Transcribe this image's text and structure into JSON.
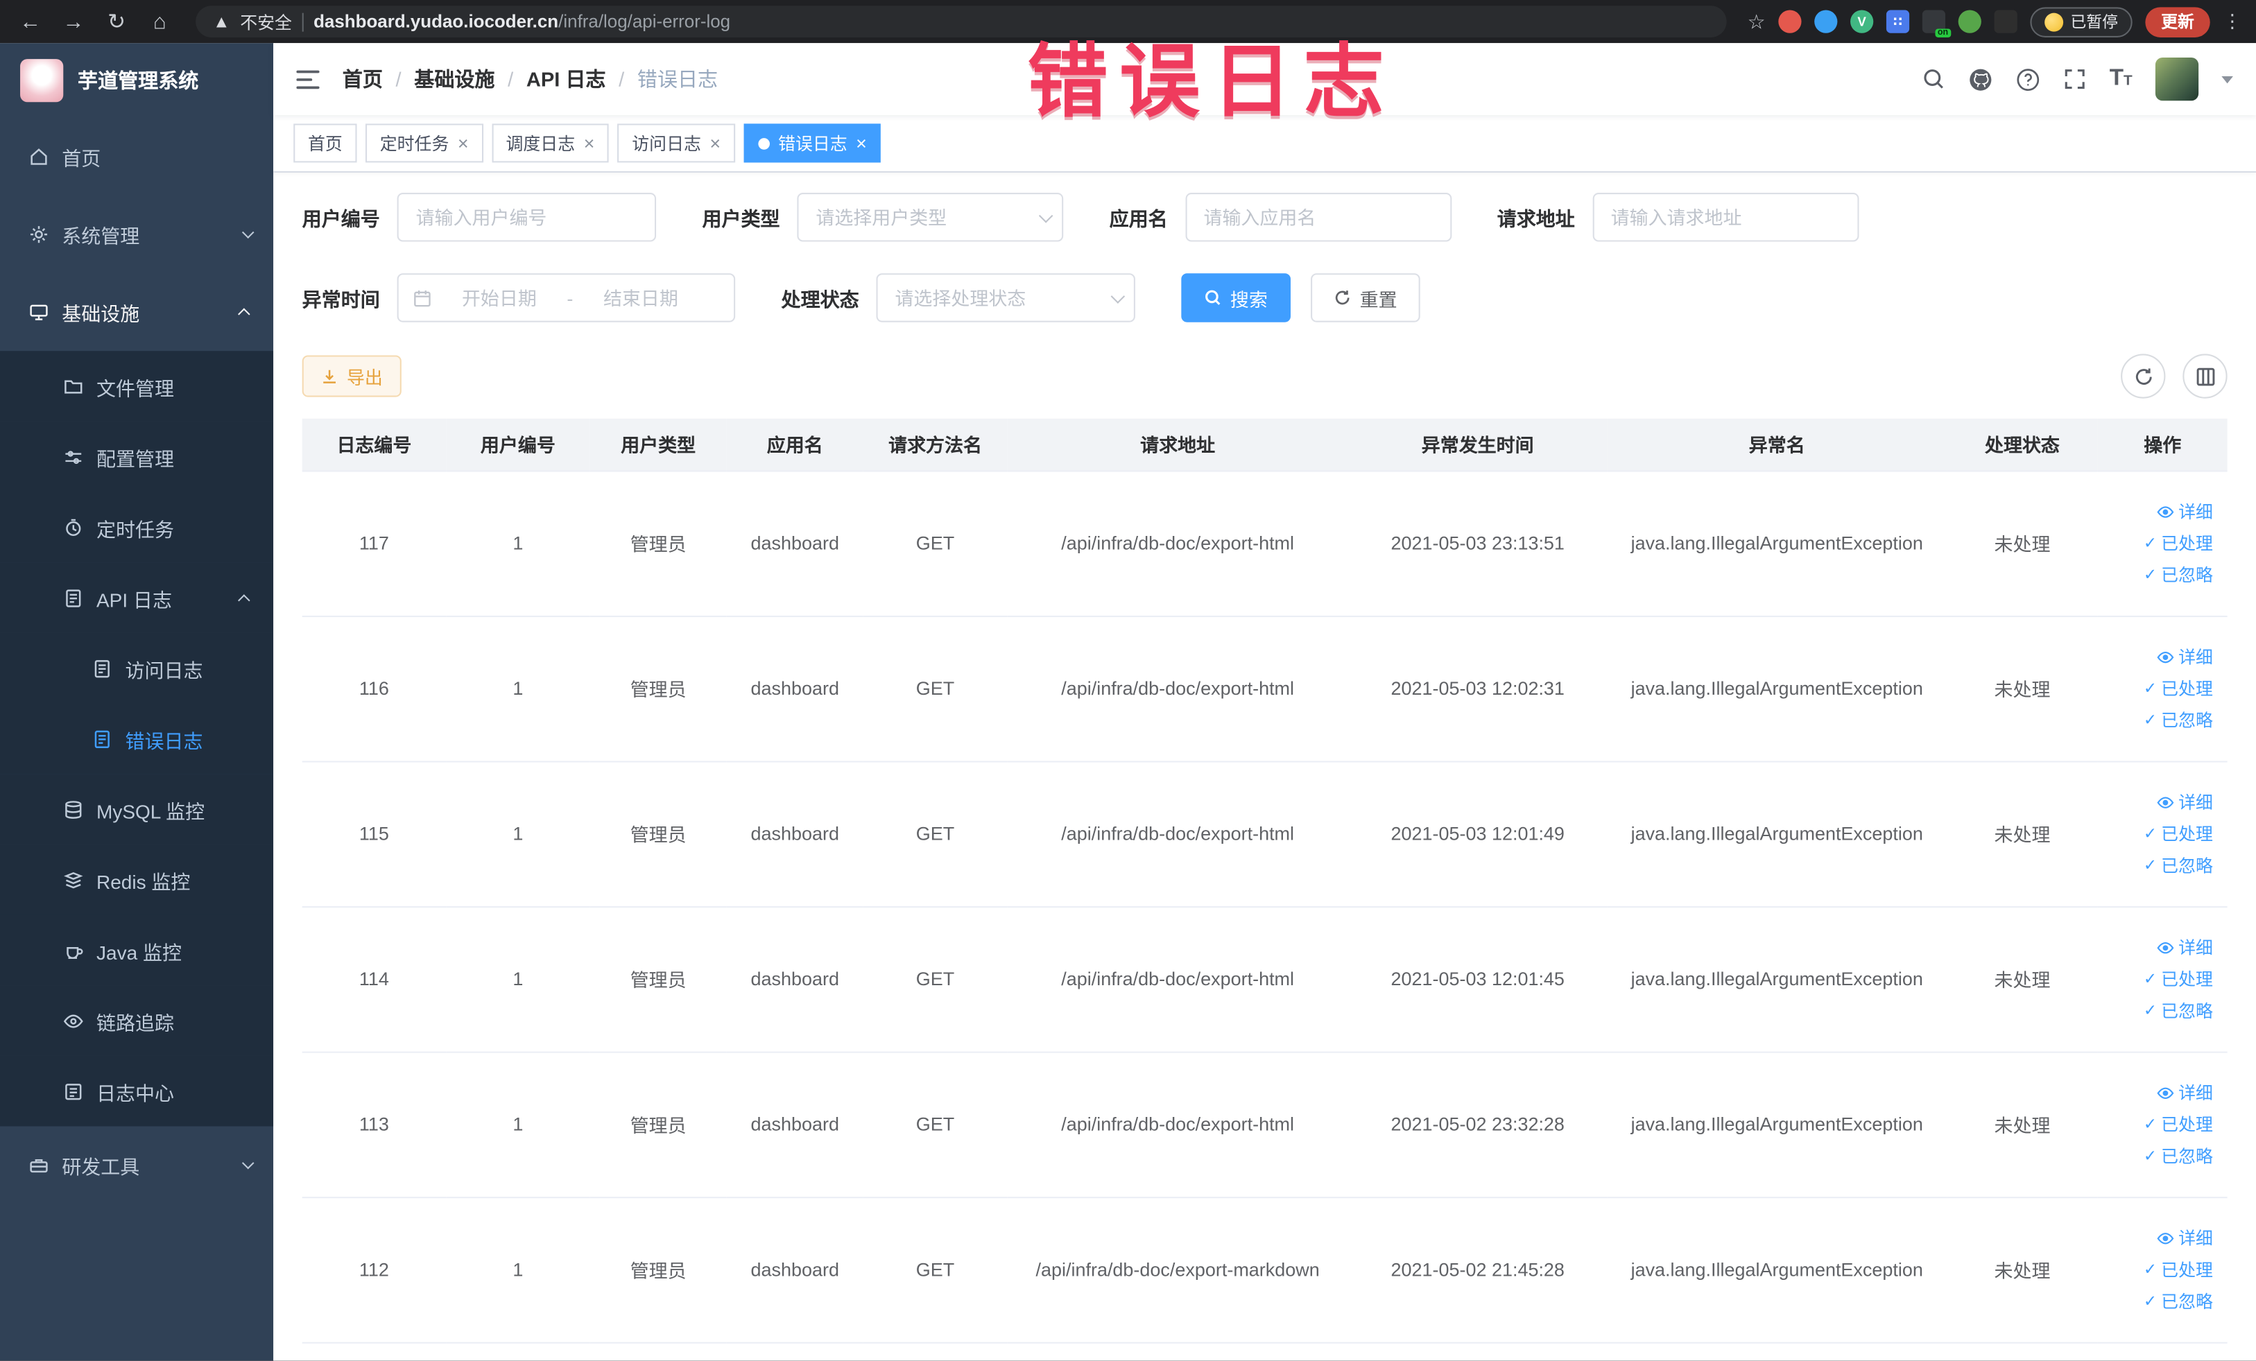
{
  "watermark": "错误日志",
  "browser": {
    "security_label": "不安全",
    "url_host": "dashboard.yudao.iocoder.cn",
    "url_path": "/infra/log/api-error-log",
    "paused_label": "已暂停",
    "update_label": "更新"
  },
  "sidebar": {
    "app_title": "芋道管理系统",
    "items": [
      {
        "label": "首页"
      },
      {
        "label": "系统管理"
      },
      {
        "label": "基础设施"
      },
      {
        "label": "文件管理"
      },
      {
        "label": "配置管理"
      },
      {
        "label": "定时任务"
      },
      {
        "label": "API 日志"
      },
      {
        "label": "访问日志"
      },
      {
        "label": "错误日志"
      },
      {
        "label": "MySQL 监控"
      },
      {
        "label": "Redis 监控"
      },
      {
        "label": "Java 监控"
      },
      {
        "label": "链路追踪"
      },
      {
        "label": "日志中心"
      },
      {
        "label": "研发工具"
      }
    ]
  },
  "header": {
    "breadcrumb": [
      "首页",
      "基础设施",
      "API 日志",
      "错误日志"
    ]
  },
  "tabs": [
    {
      "label": "首页"
    },
    {
      "label": "定时任务"
    },
    {
      "label": "调度日志"
    },
    {
      "label": "访问日志"
    },
    {
      "label": "错误日志"
    }
  ],
  "filters": {
    "user_id_label": "用户编号",
    "user_id_placeholder": "请输入用户编号",
    "user_type_label": "用户类型",
    "user_type_placeholder": "请选择用户类型",
    "app_name_label": "应用名",
    "app_name_placeholder": "请输入应用名",
    "request_url_label": "请求地址",
    "request_url_placeholder": "请输入请求地址",
    "time_label": "异常时间",
    "time_start_placeholder": "开始日期",
    "time_separator": "-",
    "time_end_placeholder": "结束日期",
    "status_label": "处理状态",
    "status_placeholder": "请选择处理状态",
    "search_label": "搜索",
    "reset_label": "重置"
  },
  "toolbar": {
    "export_label": "导出"
  },
  "table": {
    "columns": [
      "日志编号",
      "用户编号",
      "用户类型",
      "应用名",
      "请求方法名",
      "请求地址",
      "异常发生时间",
      "异常名",
      "处理状态",
      "操作"
    ],
    "actions": {
      "detail": "详细",
      "processed": "已处理",
      "ignored": "已忽略"
    },
    "rows": [
      {
        "id": "117",
        "user_id": "1",
        "user_type": "管理员",
        "app": "dashboard",
        "method": "GET",
        "url": "/api/infra/db-doc/export-html",
        "time": "2021-05-03 23:13:51",
        "exception": "java.lang.IllegalArgumentException",
        "status": "未处理"
      },
      {
        "id": "116",
        "user_id": "1",
        "user_type": "管理员",
        "app": "dashboard",
        "method": "GET",
        "url": "/api/infra/db-doc/export-html",
        "time": "2021-05-03 12:02:31",
        "exception": "java.lang.IllegalArgumentException",
        "status": "未处理"
      },
      {
        "id": "115",
        "user_id": "1",
        "user_type": "管理员",
        "app": "dashboard",
        "method": "GET",
        "url": "/api/infra/db-doc/export-html",
        "time": "2021-05-03 12:01:49",
        "exception": "java.lang.IllegalArgumentException",
        "status": "未处理"
      },
      {
        "id": "114",
        "user_id": "1",
        "user_type": "管理员",
        "app": "dashboard",
        "method": "GET",
        "url": "/api/infra/db-doc/export-html",
        "time": "2021-05-03 12:01:45",
        "exception": "java.lang.IllegalArgumentException",
        "status": "未处理"
      },
      {
        "id": "113",
        "user_id": "1",
        "user_type": "管理员",
        "app": "dashboard",
        "method": "GET",
        "url": "/api/infra/db-doc/export-html",
        "time": "2021-05-02 23:32:28",
        "exception": "java.lang.IllegalArgumentException",
        "status": "未处理"
      },
      {
        "id": "112",
        "user_id": "1",
        "user_type": "管理员",
        "app": "dashboard",
        "method": "GET",
        "url": "/api/infra/db-doc/export-markdown",
        "time": "2021-05-02 21:45:28",
        "exception": "java.lang.IllegalArgumentException",
        "status": "未处理"
      }
    ]
  }
}
